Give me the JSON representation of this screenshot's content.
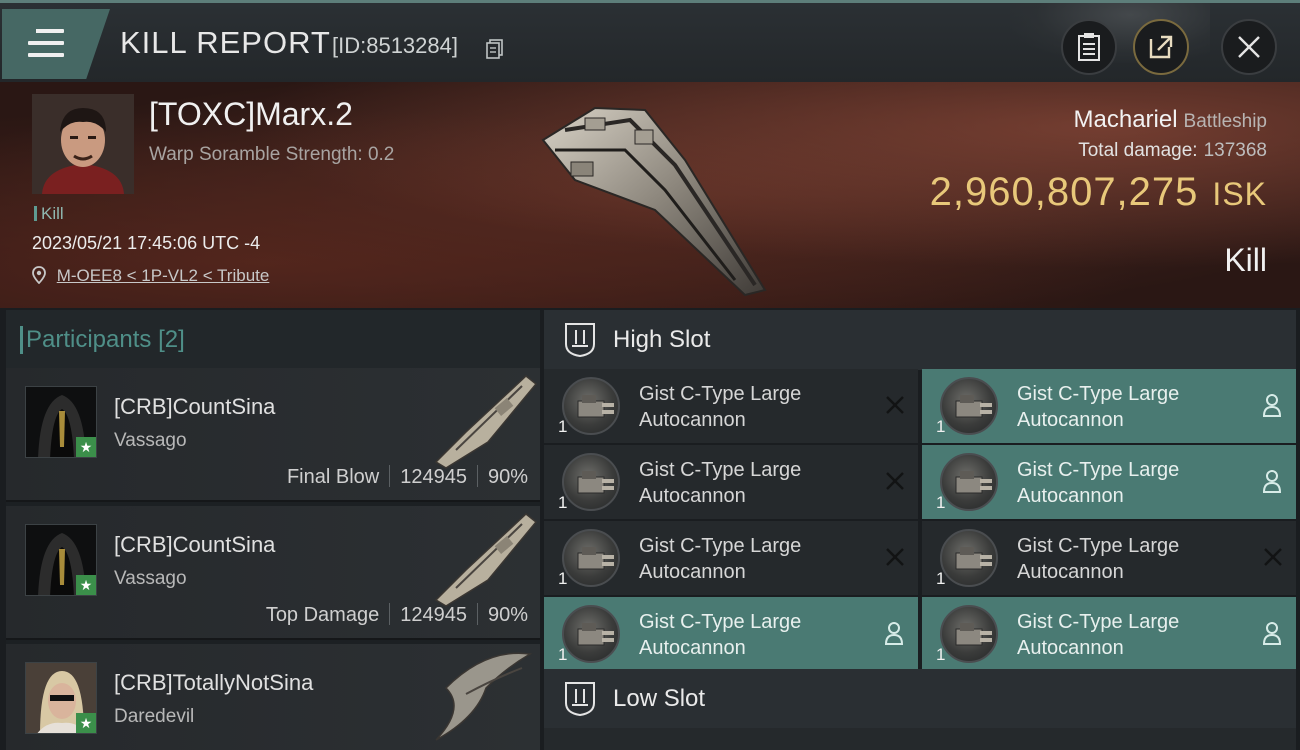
{
  "header": {
    "title": "KILL REPORT",
    "id_text": "[ID:8513284]",
    "icons": [
      "menu-icon",
      "copy-icon",
      "clipboard-icon",
      "share-icon",
      "close-icon"
    ]
  },
  "victim": {
    "name": "[TOXC]Marx.2",
    "subtitle": "Warp Soramble Strength: 0.2",
    "tag": "Kill",
    "date": "2023/05/21 17:45:06 UTC -4",
    "location": "M-OEE8 < 1P-VL2 < Tribute",
    "ship_name": "Machariel",
    "ship_class": "Battleship",
    "damage_label": "Total damage:",
    "damage_value": "137368",
    "isk_value": "2,960,807,275",
    "isk_unit": "ISK",
    "result": "Kill"
  },
  "participants": {
    "label": "Participants",
    "count": "[2]",
    "rows": [
      {
        "name": "[CRB]CountSina",
        "ship": "Vassago",
        "role": "Final Blow",
        "damage": "124945",
        "percent": "90%"
      },
      {
        "name": "[CRB]CountSina",
        "ship": "Vassago",
        "role": "Top Damage",
        "damage": "124945",
        "percent": "90%"
      },
      {
        "name": "[CRB]TotallyNotSina",
        "ship": "Daredevil",
        "role": "",
        "damage": "",
        "percent": ""
      }
    ]
  },
  "slots": {
    "high_label": "High Slot",
    "low_label": "Low Slot",
    "modules": [
      {
        "line1": "Gist C-Type Large",
        "line2": "Autocannon",
        "qty": "1",
        "status": "destroyed"
      },
      {
        "line1": "Gist C-Type Large",
        "line2": "Autocannon",
        "qty": "1",
        "status": "destroyed"
      },
      {
        "line1": "Gist C-Type Large",
        "line2": "Autocannon",
        "qty": "1",
        "status": "destroyed"
      },
      {
        "line1": "Gist C-Type Large",
        "line2": "Autocannon",
        "qty": "1",
        "status": "dropped"
      },
      {
        "line1": "Gist C-Type Large",
        "line2": "Autocannon",
        "qty": "1",
        "status": "dropped"
      },
      {
        "line1": "Gist C-Type Large",
        "line2": "Autocannon",
        "qty": "1",
        "status": "dropped"
      },
      {
        "line1": "Gist C-Type Large",
        "line2": "Autocannon",
        "qty": "1",
        "status": "destroyed"
      },
      {
        "line1": "Gist C-Type Large",
        "line2": "Autocannon",
        "qty": "1",
        "status": "dropped"
      }
    ]
  },
  "colors": {
    "accent_teal": "#4a7a73",
    "isk_gold": "#e8c87a",
    "participants_label": "#4f8f88"
  }
}
